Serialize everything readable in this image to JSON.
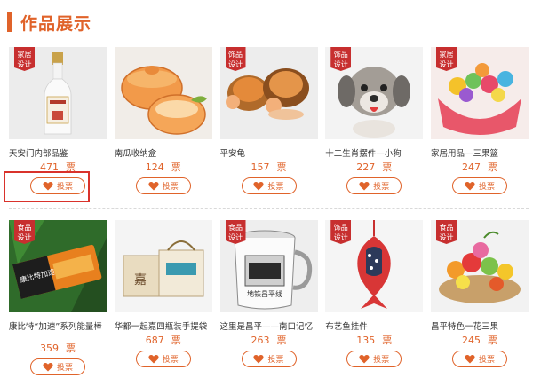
{
  "section": {
    "title": "作品展示"
  },
  "row1": [
    {
      "badge": "家居设计",
      "name": "天安门内部品鉴",
      "votes": "471",
      "unit": "票",
      "button": "投票"
    },
    {
      "badge": "家居设计",
      "name": "南瓜收纳盒",
      "votes": "124",
      "unit": "票",
      "button": "投票"
    },
    {
      "badge": "饰品设计",
      "name": "平安龟",
      "votes": "157",
      "unit": "票",
      "button": "投票"
    },
    {
      "badge": "饰品设计",
      "name": "十二生肖摆件—小狗",
      "votes": "227",
      "unit": "票",
      "button": "投票"
    },
    {
      "badge": "家居设计",
      "name": "家居用品—三果篮",
      "votes": "247",
      "unit": "票",
      "button": "投票"
    }
  ],
  "row2": [
    {
      "badge": "食品设计",
      "name": "康比特“加速”系列能量棒",
      "votes": "359",
      "unit": "票",
      "button": "投票"
    },
    {
      "badge": "食品设计",
      "name": "华都一起嘉四瓶装手提袋",
      "votes": "687",
      "unit": "票",
      "button": "投票"
    },
    {
      "badge": "食品设计",
      "name": "这里是昌平——南口记忆",
      "votes": "263",
      "unit": "票",
      "button": "投票"
    },
    {
      "badge": "饰品设计",
      "name": "布艺鱼挂件",
      "votes": "135",
      "unit": "票",
      "button": "投票"
    },
    {
      "badge": "食品设计",
      "name": "昌平特色一花三果",
      "votes": "245",
      "unit": "票",
      "button": "投票"
    }
  ],
  "mug_text": "地铁昌平线",
  "bag_text": "嘉",
  "bar_text": "康比特加速",
  "colors": {
    "accent": "#e0632a",
    "badge": "#c72f2f",
    "highlight": "#d9322b"
  }
}
